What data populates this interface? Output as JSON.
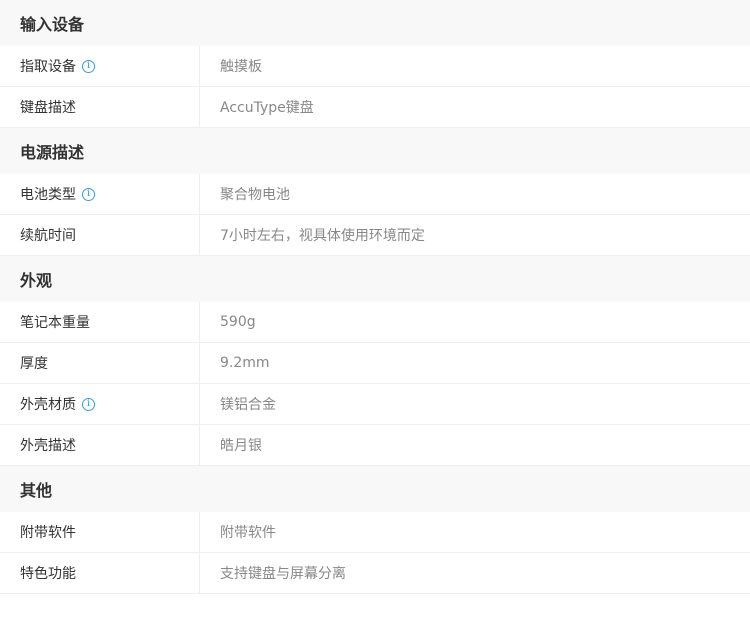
{
  "sections": [
    {
      "title": "输入设备",
      "rows": [
        {
          "label": "指取设备",
          "value": "触摸板",
          "info": true
        },
        {
          "label": "键盘描述",
          "value": "AccuType键盘",
          "info": false
        }
      ]
    },
    {
      "title": "电源描述",
      "rows": [
        {
          "label": "电池类型",
          "value": "聚合物电池",
          "info": true
        },
        {
          "label": "续航时间",
          "value": "7小时左右，视具体使用环境而定",
          "info": false
        }
      ]
    },
    {
      "title": "外观",
      "rows": [
        {
          "label": "笔记本重量",
          "value": "590g",
          "info": false
        },
        {
          "label": "厚度",
          "value": "9.2mm",
          "info": false
        },
        {
          "label": "外壳材质",
          "value": "镁铝合金",
          "info": true
        },
        {
          "label": "外壳描述",
          "value": "皓月银",
          "info": false
        }
      ]
    },
    {
      "title": "其他",
      "rows": [
        {
          "label": "附带软件",
          "value": "附带软件",
          "info": false
        },
        {
          "label": "特色功能",
          "value": "支持键盘与屏幕分离",
          "info": false
        }
      ]
    }
  ],
  "info_icon": {
    "name": "info-icon",
    "glyph": "i",
    "color": "#3f9bd8"
  }
}
